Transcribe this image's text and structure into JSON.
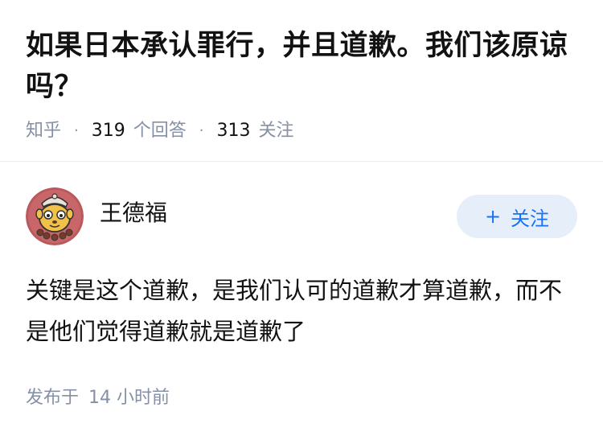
{
  "question": {
    "title": "如果日本承认罪行，并且道歉。我们该原谅吗？",
    "source": "知乎",
    "separator": "·",
    "answer_count": "319",
    "answer_label": "个回答",
    "follow_count": "313",
    "follow_label": "关注"
  },
  "answer": {
    "author_name": "王德福",
    "follow_button_icon": "+",
    "follow_button_label": "关注",
    "content": "关键是这个道歉，是我们认可的道歉才算道歉，而不是他们觉得道歉就是道歉了",
    "time_prefix": "发布于",
    "time_value": "14 小时前"
  },
  "colors": {
    "accent": "#1772f6",
    "button_bg": "#e5eef9",
    "meta_text": "#8590a6",
    "body_text": "#121212",
    "divider": "#ebebeb"
  }
}
